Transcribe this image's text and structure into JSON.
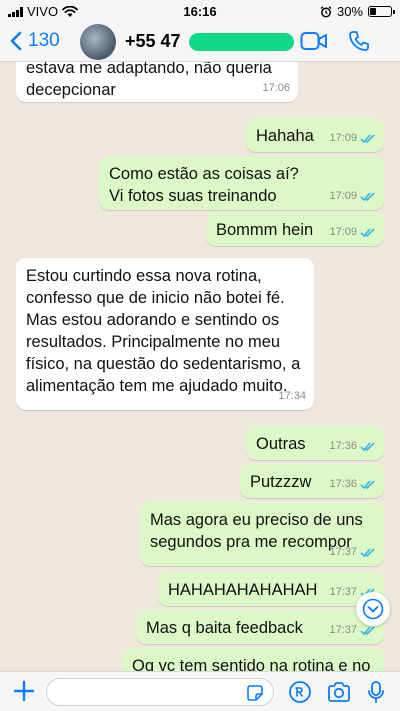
{
  "status_bar": {
    "carrier": "VIVO",
    "time": "16:16",
    "battery": "30%",
    "battery_level": 0.3
  },
  "header": {
    "back_count": "130",
    "contact_number": "+55 47"
  },
  "messages": [
    {
      "direction": "in",
      "text": "estava me adaptando, não queria\ndecepcionar",
      "time": "17:06"
    },
    {
      "direction": "out",
      "text": "Hahaha",
      "time": "17:09",
      "read": true
    },
    {
      "direction": "out",
      "text": "Como estão as coisas aí?\nVi fotos suas treinando",
      "time": "17:09",
      "read": true
    },
    {
      "direction": "out",
      "text": "Bommm hein",
      "time": "17:09",
      "read": true
    },
    {
      "direction": "in",
      "text": "Estou curtindo essa nova rotina,\nconfesso que de inicio não botei fé.\nMas estou adorando e sentindo os\nresultados. Principalmente no meu\nfísico, na questão do sedentarismo, a\nalimentação tem me ajudado muito.",
      "time": "17:34"
    },
    {
      "direction": "out",
      "text": "Outras",
      "time": "17:36",
      "read": true
    },
    {
      "direction": "out",
      "text": "Putzzzw",
      "time": "17:36",
      "read": true
    },
    {
      "direction": "out",
      "text": "Mas agora eu preciso de uns\nsegundos pra me recompor",
      "time": "17:37",
      "read": true
    },
    {
      "direction": "out",
      "text": "HAHAHAHAHAHAH",
      "time": "17:37",
      "read": true
    },
    {
      "direction": "out",
      "text": "Mas q baita feedback",
      "time": "17:37",
      "read": true
    },
    {
      "direction": "out",
      "text": "Oq vc tem sentido na rotina e no",
      "time": "",
      "read": false
    }
  ],
  "input": {
    "value": "",
    "placeholder": ""
  },
  "icons": {
    "back": "chevron-left-icon",
    "video": "video-camera-icon",
    "call": "phone-icon",
    "scroll": "chevron-down-icon",
    "attach": "plus-icon",
    "sticker": "sticker-icon",
    "payment": "pix-payment-icon",
    "camera": "camera-icon",
    "mic": "microphone-icon"
  },
  "colors": {
    "accent": "#0a7cff",
    "outgoing_bubble": "#dcf8c6",
    "incoming_bubble": "#ffffff",
    "read_ticks": "#34b7f1",
    "chat_background": "#efe7dd"
  }
}
